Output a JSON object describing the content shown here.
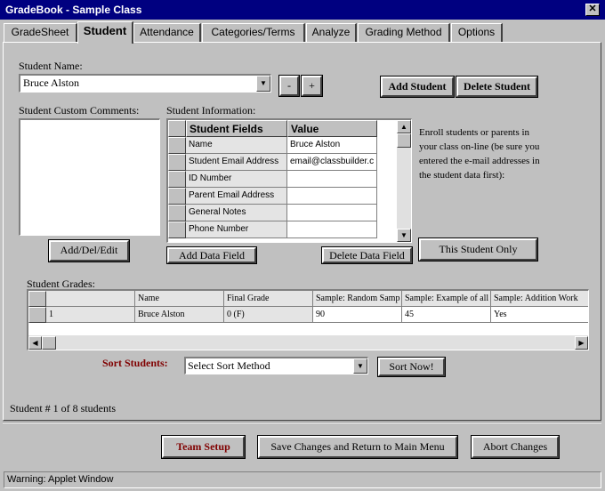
{
  "window": {
    "title": "GradeBook - Sample Class",
    "close_glyph": "✕"
  },
  "tabs": [
    {
      "label": "GradeSheet"
    },
    {
      "label": "Student"
    },
    {
      "label": "Attendance"
    },
    {
      "label": "Categories/Terms"
    },
    {
      "label": "Analyze"
    },
    {
      "label": "Grading Method"
    },
    {
      "label": "Options"
    }
  ],
  "student_name": {
    "label": "Student Name:",
    "value": "Bruce Alston",
    "minus": "-",
    "plus": "+",
    "add_student": "Add Student",
    "delete_student": "Delete Student"
  },
  "comments": {
    "label": "Student Custom Comments:",
    "button": "Add/Del/Edit"
  },
  "info": {
    "label": "Student Information:",
    "headers": [
      "Student Fields",
      "Value"
    ],
    "rows": [
      {
        "field": "Name",
        "value": "Bruce Alston"
      },
      {
        "field": "Student Email Address",
        "value": "email@classbuilder.c"
      },
      {
        "field": "ID Number",
        "value": ""
      },
      {
        "field": "Parent Email Address",
        "value": ""
      },
      {
        "field": "General Notes",
        "value": ""
      },
      {
        "field": "Phone Number",
        "value": ""
      }
    ],
    "add_field": "Add Data Field",
    "delete_field": "Delete Data Field"
  },
  "enroll": {
    "text": "Enroll students or parents in your class on-line (be sure you entered the e-mail addresses in the student data first):",
    "button": "This Student Only"
  },
  "grades": {
    "label": "Student Grades:",
    "headers": [
      "",
      "Name",
      "Final Grade",
      "Sample: Random Samp",
      "Sample: Example of all",
      "Sample: Addition Work"
    ],
    "rows": [
      [
        "1",
        "Bruce Alston",
        "0 (F)",
        "90",
        "45",
        "Yes"
      ]
    ]
  },
  "sort": {
    "label": "Sort Students:",
    "value": "Select Sort Method",
    "button": "Sort Now!",
    "label_color": "#800000"
  },
  "student_count": "Student # 1 of 8 students",
  "footer": {
    "team_setup": "Team Setup",
    "save_return": "Save Changes and Return to Main Menu",
    "abort": "Abort Changes",
    "team_color": "#800000"
  },
  "status": "Warning: Applet Window"
}
